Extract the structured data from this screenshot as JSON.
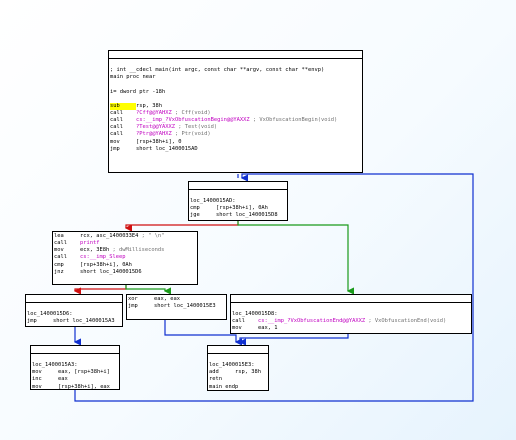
{
  "graph": {
    "nodes": [
      {
        "id": "main",
        "lines": [
          {
            "t": ""
          },
          {
            "t": "; int __cdecl main(int argc, const char **argv, const char **envp)"
          },
          {
            "t": "main proc near"
          },
          {
            "t": ""
          },
          {
            "t": "i= dword ptr -18h"
          },
          {
            "t": ""
          },
          {
            "m": "sub",
            "o": "rsp, 38h",
            "hl": true
          },
          {
            "m": "call",
            "o": "?Cff@@YAHXZ",
            "c": "; Cff(void)"
          },
          {
            "m": "call",
            "o": "cs:__imp_?VxObfuscationBegin@@YAXXZ",
            "c": "; VxObfuscationBegin(void)"
          },
          {
            "m": "call",
            "o": "?Test@@YAXXZ",
            "c": "; Test(void)"
          },
          {
            "m": "call",
            "o": "?Ptr@@YAHXZ",
            "c": "; Ptr(void)"
          },
          {
            "m": "mov",
            "o": "[rsp+38h+i], 0"
          },
          {
            "m": "jmp",
            "o": "short loc_1400015AD"
          }
        ]
      },
      {
        "id": "loc_1400015AD",
        "lines": [
          {
            "t": ""
          },
          {
            "t": "loc_1400015AD:"
          },
          {
            "m": "cmp",
            "o": "[rsp+38h+i], 0Ah"
          },
          {
            "m": "jge",
            "o": "short loc_1400015D8"
          }
        ]
      },
      {
        "id": "loop_body",
        "lines": [
          {
            "m": "lea",
            "o": "rcx, asc_1400033E4",
            "c": "; \" \\n\""
          },
          {
            "m": "call",
            "o": "printf"
          },
          {
            "m": "mov",
            "o": "ecx, 3E8h",
            "c": "; dwMilliseconds"
          },
          {
            "m": "call",
            "o": "cs:__imp_Sleep"
          },
          {
            "m": "cmp",
            "o": "[rsp+38h+i], 0Ah"
          },
          {
            "m": "jnz",
            "o": "short loc_1400015D6"
          }
        ]
      },
      {
        "id": "loc_1400015D6",
        "lines": [
          {
            "t": ""
          },
          {
            "t": "loc_1400015D6:"
          },
          {
            "m": "jmp",
            "o": "short loc_1400015A3"
          }
        ]
      },
      {
        "id": "xor_block",
        "lines": [
          {
            "m": "xor",
            "o": "eax, eax"
          },
          {
            "m": "jmp",
            "o": "short loc_1400015E3"
          }
        ]
      },
      {
        "id": "loc_1400015D8",
        "lines": [
          {
            "t": ""
          },
          {
            "t": "loc_1400015D8:"
          },
          {
            "m": "call",
            "o": "cs:__imp_?VxObfuscationEnd@@YAXXZ",
            "c": "; VxObfuscationEnd(void)"
          },
          {
            "m": "mov",
            "o": "eax, 1"
          }
        ]
      },
      {
        "id": "loc_1400015A3",
        "lines": [
          {
            "t": ""
          },
          {
            "t": "loc_1400015A3:"
          },
          {
            "m": "mov",
            "o": "eax, [rsp+38h+i]"
          },
          {
            "m": "inc",
            "o": "eax"
          },
          {
            "m": "mov",
            "o": "[rsp+38h+i], eax"
          }
        ]
      },
      {
        "id": "loc_1400015E3",
        "lines": [
          {
            "t": ""
          },
          {
            "t": "loc_1400015E3:"
          },
          {
            "m": "add",
            "o": "rsp, 38h"
          },
          {
            "m": "retn"
          },
          {
            "t": "main endp"
          }
        ]
      }
    ],
    "colors": {
      "true_branch": "#1a9a1a",
      "false_branch": "#d01010",
      "unconditional": "#1030d0",
      "function_name": "#c000c0",
      "comment": "#707070",
      "highlight": "#ffff00"
    }
  }
}
